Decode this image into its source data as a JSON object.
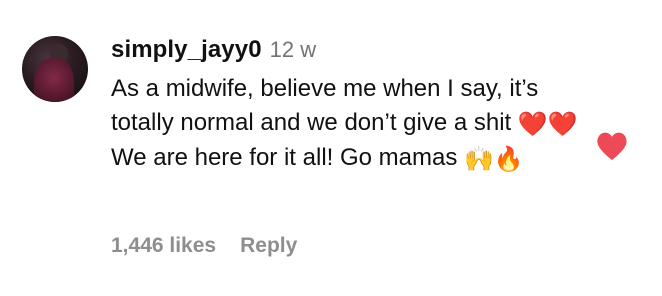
{
  "comment": {
    "username": "simply_jayy0",
    "timestamp": "12 w",
    "text_part1": "As a midwife, believe me when I say, it’s totally normal and we don’t give a shit",
    "emoji_hearts": "❤️❤️",
    "text_part2": "We are here for it all! Go mamas",
    "emoji_hands": "🙌",
    "emoji_fire": "🔥",
    "likes_count": "1,446 likes",
    "reply_label": "Reply",
    "liked": true
  },
  "colors": {
    "like_heart": "#ed4956",
    "secondary_text": "#8e8e8e",
    "timestamp_text": "#737373"
  },
  "icons": {
    "avatar": "avatar",
    "like": "heart-icon"
  }
}
